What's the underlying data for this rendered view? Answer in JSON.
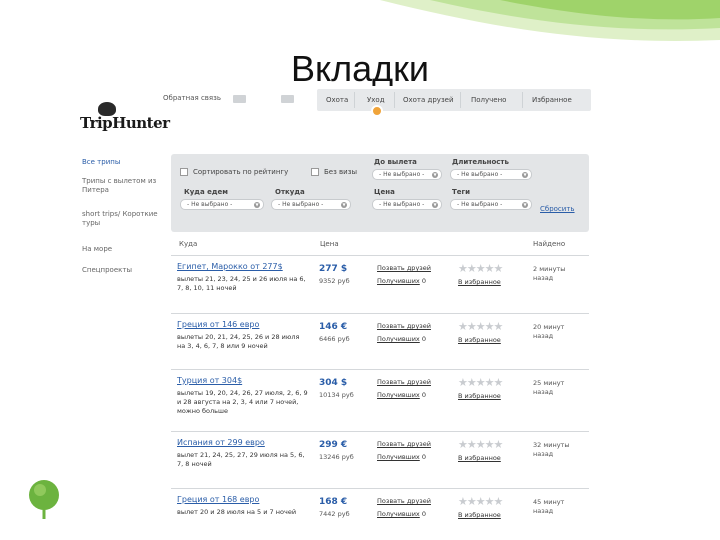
{
  "slide": {
    "title": "Вкладки"
  },
  "topbar": {
    "feedback": "Обратная связь",
    "tabs": [
      "Охота",
      "Уход",
      "Охота друзей",
      "Получено",
      "Избранное"
    ]
  },
  "logo": {
    "text": "TripHunter"
  },
  "sidebar": {
    "items": [
      {
        "label": "Все трипы"
      },
      {
        "label": "Трипы с вылетом из Питера"
      },
      {
        "label": "short trips/ Короткие туры"
      },
      {
        "label": "На море"
      },
      {
        "label": "Спецпроекты"
      }
    ]
  },
  "filters": {
    "sort_label": "Сортировать по рейтингу",
    "no_visa_label": "Без визы",
    "days_label": "До вылета",
    "duration_label": "Длительность",
    "where_label": "Куда едем",
    "from_label": "Откуда",
    "price_label": "Цена",
    "tags_label": "Теги",
    "not_selected": "- Не выбрано -",
    "reset": "Сбросить"
  },
  "table": {
    "headers": {
      "where": "Куда",
      "price": "Цена",
      "found": "Найдено"
    },
    "action_invite": "Позвать друзей",
    "action_received": "Получивших",
    "action_fav": "В избранное",
    "rows": [
      {
        "title": "Египет, Марокко от 277$",
        "desc": "вылеты 21, 23, 24, 25 и 26 июля на 6, 7, 8, 10, 11 ночей",
        "price": "277 $",
        "price_rub": "9352 руб",
        "received": "0",
        "found": "2 минуты назад"
      },
      {
        "title": "Греция от 146 евро",
        "desc": "вылеты 20, 21, 24, 25, 26 и 28 июля на 3, 4, 6, 7, 8 или 9 ночей",
        "price": "146 €",
        "price_rub": "6466 руб",
        "received": "0",
        "found": "20 минут назад"
      },
      {
        "title": "Турция от 304$",
        "desc": "вылеты 19, 20, 24, 26, 27 июля, 2, 6, 9 и 28 августа на 2, 3, 4 или 7 ночей, можно больше",
        "price": "304 $",
        "price_rub": "10134 руб",
        "received": "0",
        "found": "25 минут назад"
      },
      {
        "title": "Испания от 299 евро",
        "desc": "вылет 21, 24, 25, 27, 29 июля на 5, 6, 7, 8 ночей",
        "price": "299 €",
        "price_rub": "13246 руб",
        "received": "0",
        "found": "32 минуты назад"
      },
      {
        "title": "Греция от 168 евро",
        "desc": "вылет 20 и 28 июля на 5 и 7 ночей",
        "price": "168 €",
        "price_rub": "7442 руб",
        "received": "0",
        "found": "45 минут назад"
      }
    ]
  },
  "colors": {
    "link": "#2a5da8",
    "accent": "#f0a43a",
    "panel": "#e3e5e7",
    "leaf": "#6cb33f"
  }
}
